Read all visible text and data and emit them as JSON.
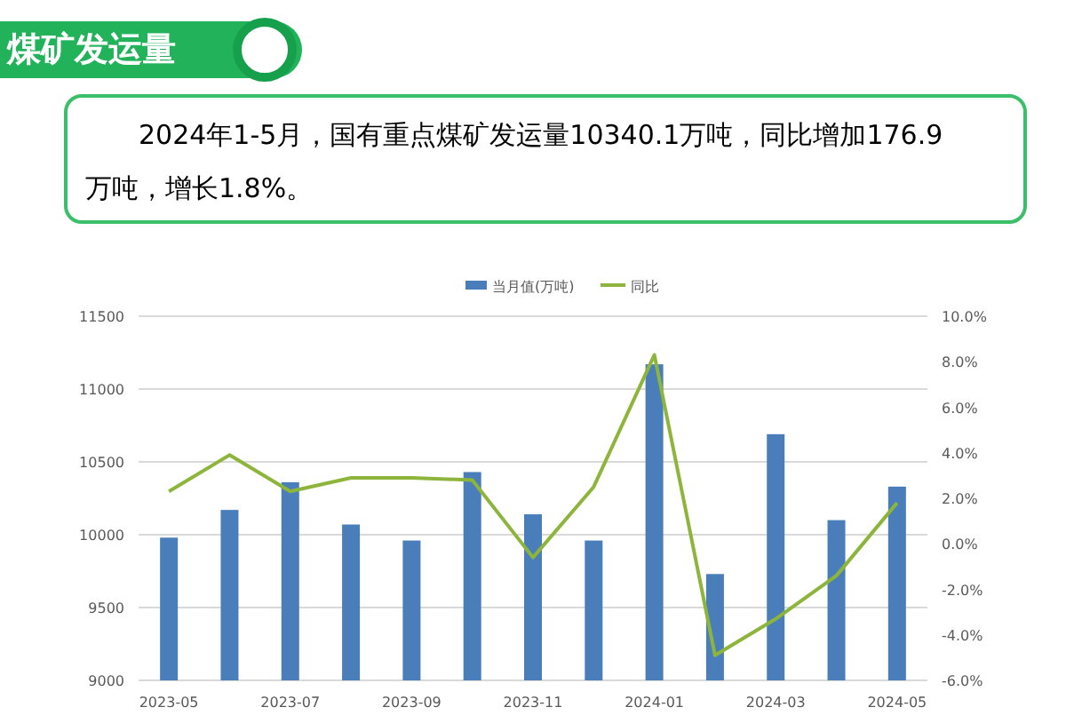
{
  "header": {
    "title": "煤矿发运量"
  },
  "summary": "2024年1-5月，国有重点煤矿发运量10340.1万吨，同比增加176.9万吨，增长1.8%。",
  "chart": {
    "chart_data": {
      "type": "bar",
      "series": [
        {
          "name": "当月值(万吨)",
          "color": "#4a7ebb",
          "values": [
            9980,
            10170,
            10360,
            10070,
            9960,
            10430,
            10140,
            9960,
            11170,
            9730,
            10690,
            10100,
            10330
          ]
        },
        {
          "name": "同比",
          "type": "line",
          "axis": "y2",
          "color": "#8db53c",
          "values": [
            2.3,
            3.9,
            2.3,
            2.9,
            2.9,
            2.8,
            -0.6,
            2.5,
            8.3,
            -4.9,
            -3.3,
            -1.4,
            1.8
          ]
        }
      ],
      "categories": [
        "2023-05",
        null,
        "2023-07",
        null,
        "2023-09",
        null,
        "2023-11",
        null,
        "2024-01",
        null,
        "2024-03",
        null,
        "2024-05"
      ],
      "grid": true,
      "legend": "top",
      "ylim": [
        9000,
        11500
      ],
      "yticks": [
        9000,
        9500,
        10000,
        10500,
        11000,
        11500
      ],
      "y2lim": [
        -6,
        10
      ],
      "y2ticks": [
        {
          "value": -6,
          "label": "-6.0%"
        },
        {
          "value": -4,
          "label": "-4.0%"
        },
        {
          "value": -2,
          "label": "-2.0%"
        },
        {
          "value": 0,
          "label": "0.0%"
        },
        {
          "value": 2,
          "label": "2.0%"
        },
        {
          "value": 4,
          "label": "4.0%"
        },
        {
          "value": 6,
          "label": "6.0%"
        },
        {
          "value": 8,
          "label": "8.0%"
        },
        {
          "value": 10,
          "label": "10.0%"
        }
      ]
    }
  }
}
